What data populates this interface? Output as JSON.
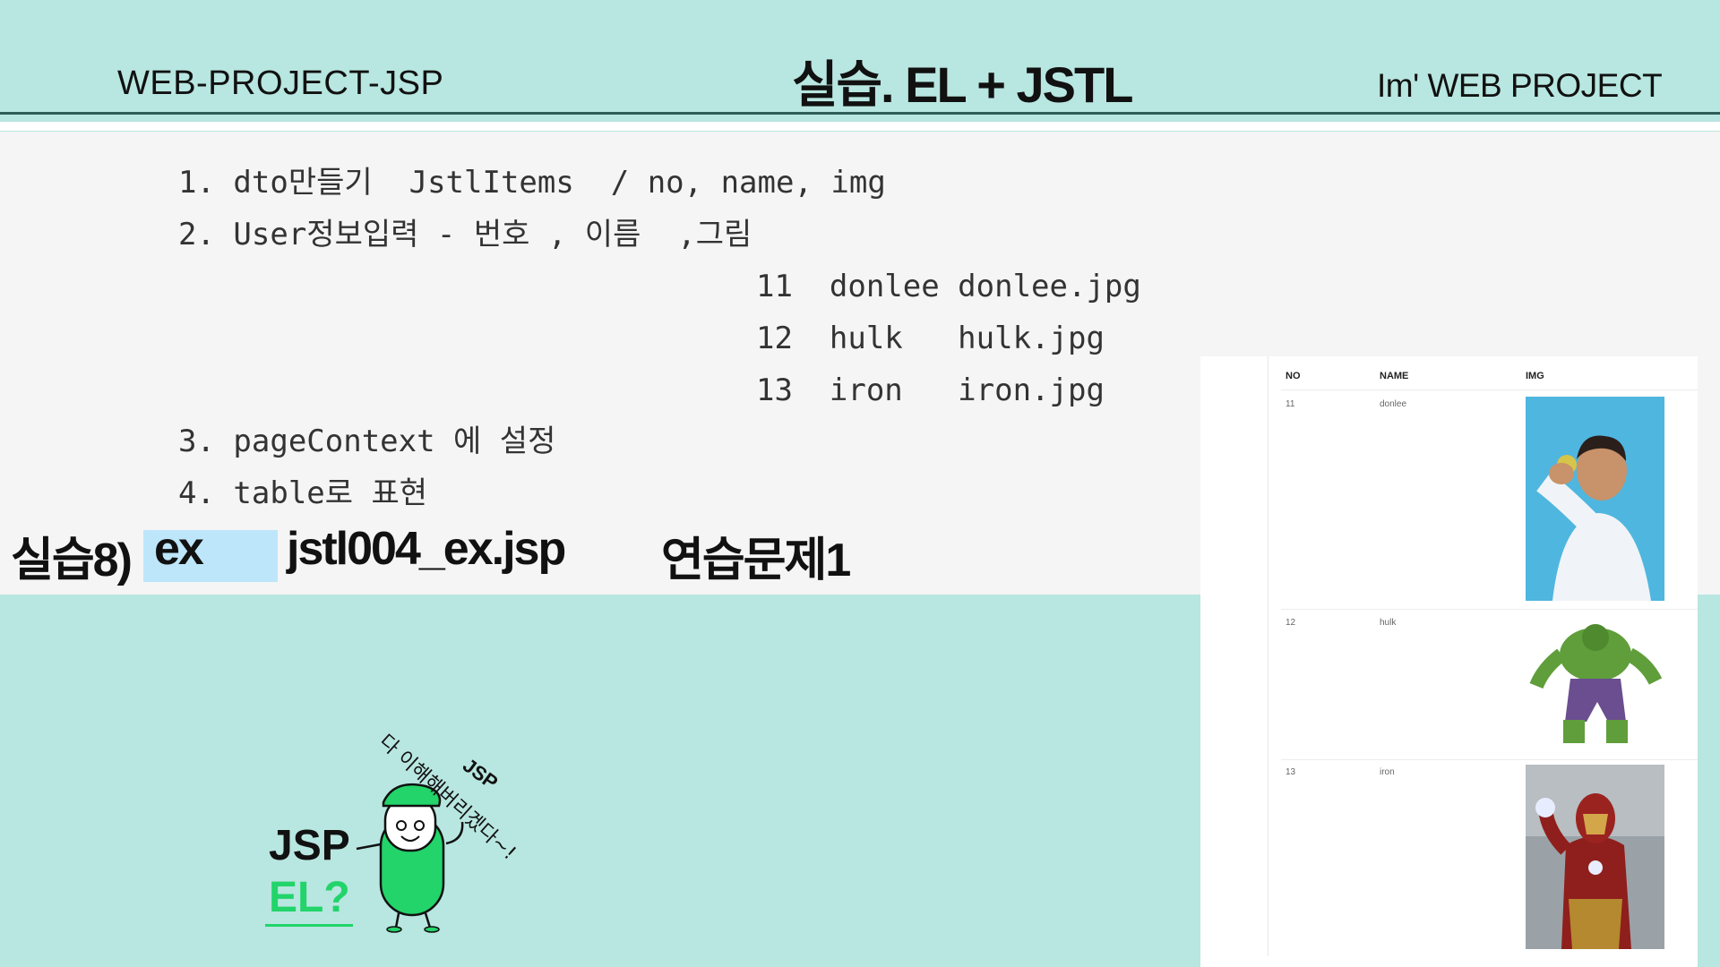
{
  "header": {
    "left_label": "WEB-PROJECT-JSP",
    "title": "실습. EL + JSTL",
    "right_label": "Im'  WEB PROJECT"
  },
  "code_lines": [
    "1. dto만들기  JstlItems  / no, name, img",
    "2. User정보입력 - 번호 , 이름  ,그림",
    "11  donlee donlee.jpg",
    "12  hulk   hulk.jpg",
    "13  iron   iron.jpg",
    "3. pageContext 에 설정",
    "4. table로 표현"
  ],
  "practice": {
    "label": "실습8)",
    "tag": "ex",
    "file": "jstl004_ex.jsp",
    "exercise": "연습문제1"
  },
  "mascot": {
    "jsp_label": "JSP",
    "el_label": "EL?",
    "speech_tag": "JSP",
    "speech": "다 이해해버리겠다~!"
  },
  "result_table": {
    "headers": [
      "NO",
      "NAME",
      "IMG"
    ],
    "rows": [
      {
        "no": "11",
        "name": "donlee",
        "image_icon": "man-holding-ball-photo"
      },
      {
        "no": "12",
        "name": "hulk",
        "image_icon": "hulk-figure-image"
      },
      {
        "no": "13",
        "name": "iron",
        "image_icon": "iron-man-figure-image"
      }
    ]
  },
  "colors": {
    "background": "#b8e6e0",
    "header_rule": "#2e5e58",
    "code_panel": "#f5f5f5",
    "highlight": "#bde6fb",
    "mascot_green": "#22d46a"
  }
}
